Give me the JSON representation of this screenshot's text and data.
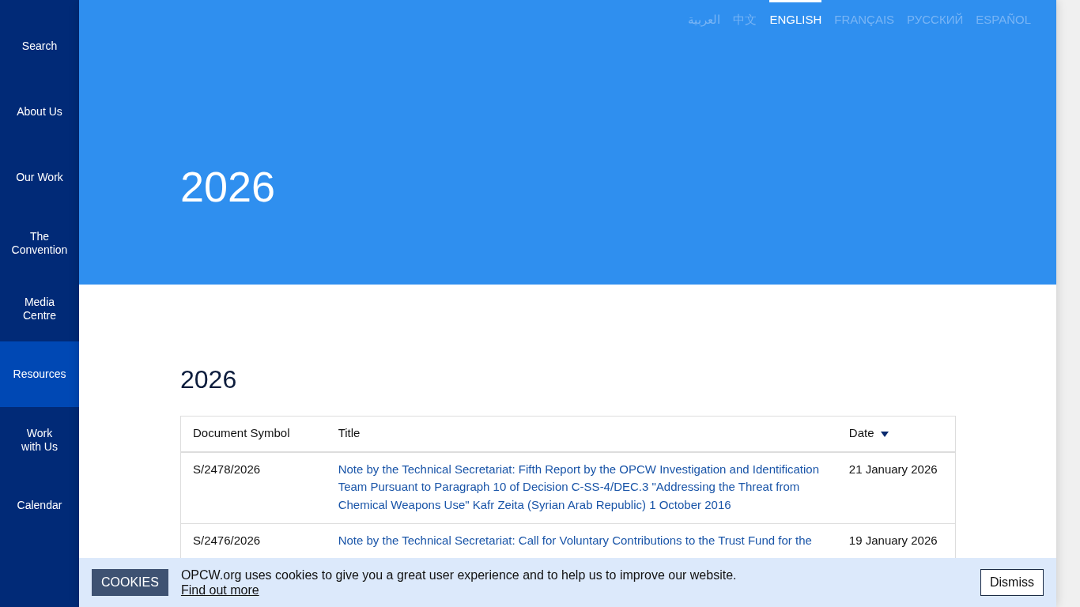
{
  "sidebar": {
    "items": [
      {
        "label": "Search",
        "selected": false
      },
      {
        "label": "About Us",
        "selected": false
      },
      {
        "label": "Our Work",
        "selected": false
      },
      {
        "label": "The\nConvention",
        "selected": false
      },
      {
        "label": "Media\nCentre",
        "selected": false
      },
      {
        "label": "Resources",
        "selected": true
      },
      {
        "label": "Work\nwith Us",
        "selected": false
      },
      {
        "label": "Calendar",
        "selected": false
      }
    ]
  },
  "languages": [
    {
      "label": "العربية",
      "selected": false
    },
    {
      "label": "中文",
      "selected": false
    },
    {
      "label": "ENGLISH",
      "selected": true
    },
    {
      "label": "FRANÇAIS",
      "selected": false
    },
    {
      "label": "РУССКИЙ",
      "selected": false
    },
    {
      "label": "ESPAÑOL",
      "selected": false
    }
  ],
  "hero": {
    "title": "2026"
  },
  "section": {
    "heading": "2026"
  },
  "table": {
    "columns": [
      {
        "label": "Document Symbol",
        "sorted": false
      },
      {
        "label": "Title",
        "sorted": false
      },
      {
        "label": "Date",
        "sorted": true
      }
    ],
    "rows": [
      {
        "symbol": "S/2478/2026",
        "title": "Note by the Technical Secretariat: Fifth Report by the OPCW Investigation and Identification Team Pursuant to Paragraph 10 of Decision C-SS-4/DEC.3 \"Addressing the Threat from Chemical Weapons Use\" Kafr Zeita (Syrian Arab Republic) 1 October 2016",
        "date": "21 January 2026"
      },
      {
        "symbol": "S/2476/2026",
        "title": "Note by the Technical Secretariat: Call for Voluntary Contributions to the Trust Fund for the",
        "date": "19 January 2026"
      }
    ]
  },
  "cookie_banner": {
    "badge": "COOKIES",
    "message": "OPCW.org uses cookies to give you a great user experience and to help us to improve our website.",
    "link": "Find out more",
    "button": "Dismiss"
  }
}
